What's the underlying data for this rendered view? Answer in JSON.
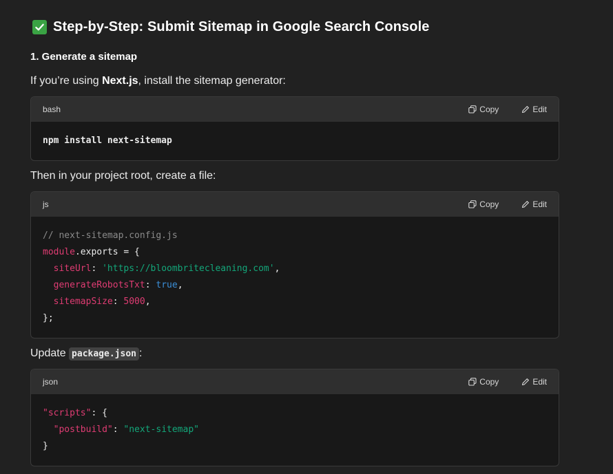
{
  "heading": {
    "icon": "check-mark-button-icon",
    "title": "Step-by-Step: Submit Sitemap in Google Search Console"
  },
  "section1": {
    "title": "1. Generate a sitemap"
  },
  "para1": {
    "before": "If you’re using ",
    "bold": "Next.js",
    "after": ", install the sitemap generator:"
  },
  "para2": {
    "text": "Then in your project root, create a file:"
  },
  "para3": {
    "before": "Update ",
    "code": "package.json",
    "after": ":"
  },
  "code_actions": {
    "copy": "Copy",
    "edit": "Edit"
  },
  "block1": {
    "lang": "bash",
    "line1": "npm install next-sitemap"
  },
  "block2": {
    "lang": "js",
    "comment": "// next-sitemap.config.js",
    "module": "module",
    "exports": ".exports = {",
    "siteUrl_key": "siteUrl",
    "siteUrl_val": "'https://bloombritecleaning.com'",
    "robots_key": "generateRobotsTxt",
    "robots_val": "true",
    "size_key": "sitemapSize",
    "size_val": "5000",
    "close": "};"
  },
  "block3": {
    "lang": "json",
    "scripts_key": "\"scripts\"",
    "open": ": {",
    "postbuild_key": "\"postbuild\"",
    "postbuild_val": "\"next-sitemap\"",
    "close": "}"
  },
  "colors": {
    "background": "#212121",
    "code_header": "#2f2f2f",
    "code_body": "#181818",
    "check": "#3aa344",
    "keyword": "#e03c73",
    "string": "#13a77a",
    "boolean": "#3b8fd9",
    "comment": "#8b8b8b"
  }
}
